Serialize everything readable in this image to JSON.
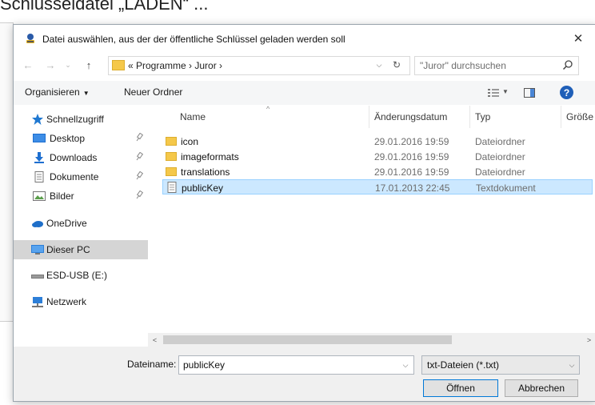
{
  "background": {
    "caption": "Schlüsseldatei „LADEN“ ..."
  },
  "dialog": {
    "title": "Datei auswählen, aus der der öffentliche Schlüssel geladen werden soll",
    "close_glyph": "✕",
    "nav": {
      "back_glyph": "←",
      "forward_glyph": "→",
      "recent_glyph": "⌄",
      "up_glyph": "↑",
      "path": "« Programme › Juror ›",
      "path_dropdown_glyph": "⌵",
      "refresh_glyph": "↻",
      "search_placeholder": "\"Juror\" durchsuchen"
    },
    "toolbar": {
      "organize_label": "Organisieren",
      "organize_caret": "▼",
      "new_folder_label": "Neuer Ordner",
      "view_caret": "▼",
      "help_glyph": "?"
    },
    "sidebar": {
      "items": [
        {
          "label": "Schnellzugriff",
          "icon": "star-icon",
          "pinned": false,
          "selected": false
        },
        {
          "label": "Desktop",
          "icon": "desktop-icon",
          "pinned": true,
          "selected": false
        },
        {
          "label": "Downloads",
          "icon": "download-icon",
          "pinned": true,
          "selected": false
        },
        {
          "label": "Dokumente",
          "icon": "document-icon",
          "pinned": true,
          "selected": false
        },
        {
          "label": "Bilder",
          "icon": "picture-icon",
          "pinned": true,
          "selected": false
        },
        {
          "label": "OneDrive",
          "icon": "cloud-icon",
          "pinned": false,
          "selected": false
        },
        {
          "label": "Dieser PC",
          "icon": "computer-icon",
          "pinned": false,
          "selected": true
        },
        {
          "label": "ESD-USB (E:)",
          "icon": "usb-drive-icon",
          "pinned": false,
          "selected": false
        },
        {
          "label": "Netzwerk",
          "icon": "network-icon",
          "pinned": false,
          "selected": false
        }
      ]
    },
    "columns": {
      "name": "Name",
      "date": "Änderungsdatum",
      "type": "Typ",
      "size": "Größe",
      "sort_glyph": "^"
    },
    "files": [
      {
        "name": "icon",
        "date": "29.01.2016 19:59",
        "type": "Dateiordner",
        "kind": "folder",
        "selected": false
      },
      {
        "name": "imageformats",
        "date": "29.01.2016 19:59",
        "type": "Dateiordner",
        "kind": "folder",
        "selected": false
      },
      {
        "name": "translations",
        "date": "29.01.2016 19:59",
        "type": "Dateiordner",
        "kind": "folder",
        "selected": false
      },
      {
        "name": "publicKey",
        "date": "17.01.2013 22:45",
        "type": "Textdokument",
        "kind": "file",
        "selected": true
      }
    ],
    "scroll": {
      "left_glyph": "<",
      "right_glyph": ">"
    },
    "footer": {
      "filename_label": "Dateiname:",
      "filename_value": "publicKey",
      "filename_dropdown_glyph": "⌵",
      "filetype_value": "txt-Dateien (*.txt)",
      "filetype_dropdown_glyph": "⌵",
      "open_label": "Öffnen",
      "cancel_label": "Abbrechen"
    }
  },
  "colors": {
    "accent": "#0078d7",
    "selection_fill": "#cce8ff",
    "selection_border": "#99d1ff",
    "folder": "#f5c84a",
    "help": "#1f5fb8"
  }
}
